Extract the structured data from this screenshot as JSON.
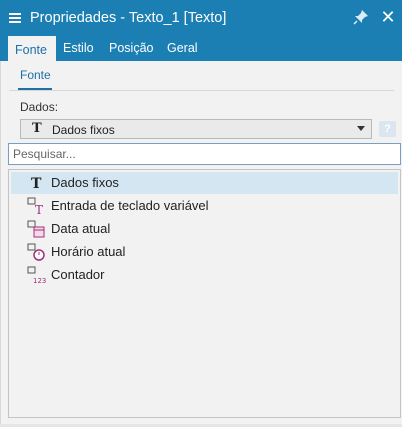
{
  "window": {
    "title": "Propriedades - Texto_1 [Texto]",
    "accent_color": "#1b7fb3"
  },
  "tabs": [
    {
      "label": "Fonte",
      "active": true
    },
    {
      "label": "Estilo",
      "active": false
    },
    {
      "label": "Posição",
      "active": false
    },
    {
      "label": "Geral",
      "active": false
    }
  ],
  "subtab": {
    "label": "Fonte"
  },
  "dados": {
    "label": "Dados:",
    "selected_value": "Dados fixos",
    "selected_icon": "text-t-icon"
  },
  "search": {
    "placeholder": "Pesquisar..."
  },
  "options": [
    {
      "label": "Dados fixos",
      "icon": "text-t-icon",
      "selected": true
    },
    {
      "label": "Entrada de teclado variável",
      "icon": "keyboard-input-icon",
      "selected": false
    },
    {
      "label": "Data atual",
      "icon": "calendar-icon",
      "selected": false
    },
    {
      "label": "Horário atual",
      "icon": "clock-icon",
      "selected": false
    },
    {
      "label": "Contador",
      "icon": "counter-icon",
      "selected": false
    }
  ]
}
